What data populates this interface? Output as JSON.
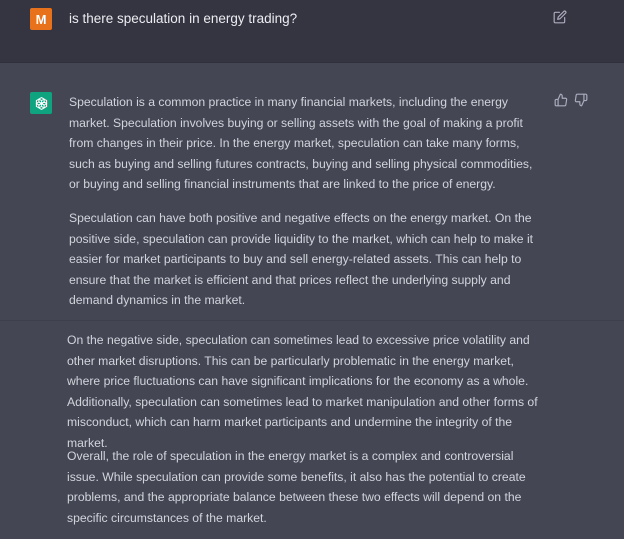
{
  "user_message": {
    "avatar_letter": "M",
    "text": "is there speculation in energy trading?",
    "avatar_color": "#e8711c"
  },
  "assistant_message": {
    "avatar_color": "#10a37f",
    "paragraphs": [
      "Speculation is a common practice in many financial markets, including the energy market. Speculation involves buying or selling assets with the goal of making a profit from changes in their price. In the energy market, speculation can take many forms, such as buying and selling futures contracts, buying and selling physical commodities, or buying and selling financial instruments that are linked to the price of energy.",
      "Speculation can have both positive and negative effects on the energy market. On the positive side, speculation can provide liquidity to the market, which can help to make it easier for market participants to buy and sell energy-related assets. This can help to ensure that the market is efficient and that prices reflect the underlying supply and demand dynamics in the market.",
      "On the negative side, speculation can sometimes lead to excessive price volatility and other market disruptions. This can be particularly problematic in the energy market, where price fluctuations can have significant implications for the economy as a whole. Additionally, speculation can sometimes lead to market manipulation and other forms of misconduct, which can harm market participants and undermine the integrity of the market.",
      "Overall, the role of speculation in the energy market is a complex and controversial issue. While speculation can provide some benefits, it also has the potential to create problems, and the appropriate balance between these two effects will depend on the specific circumstances of the market."
    ]
  },
  "icons": {
    "edit": "edit-icon",
    "thumbs_up": "thumbs-up-icon",
    "thumbs_down": "thumbs-down-icon",
    "assistant_logo": "openai-logo-icon"
  },
  "colors": {
    "user_row_bg": "#343541",
    "assistant_row_bg": "#444654",
    "text": "#d1d5db"
  }
}
